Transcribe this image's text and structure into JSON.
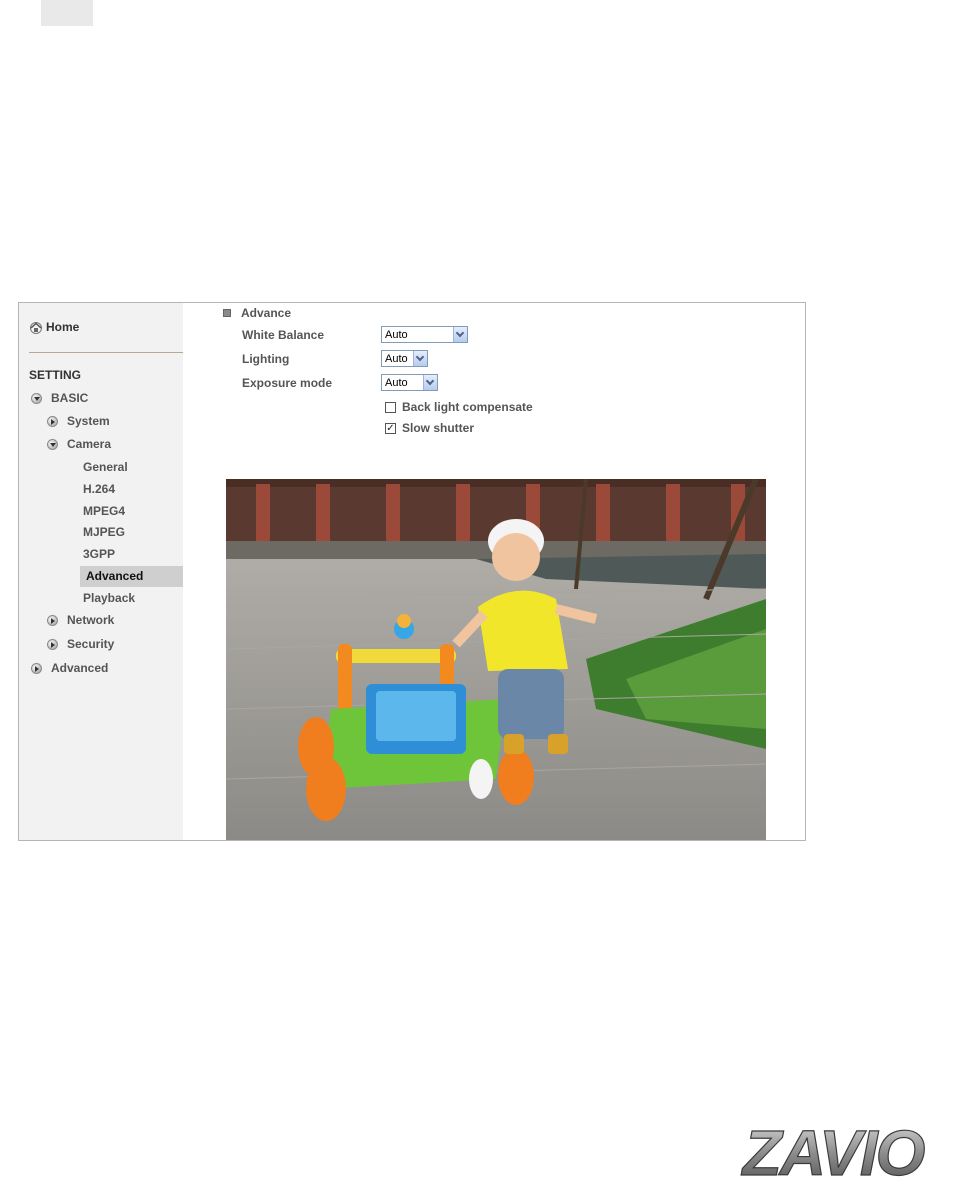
{
  "sidebar": {
    "home_label": "Home",
    "section_title": "SETTING",
    "basic_label": "BASIC",
    "system_label": "System",
    "camera_label": "Camera",
    "camera_sub": [
      "General",
      "H.264",
      "MPEG4",
      "MJPEG",
      "3GPP",
      "Advanced",
      "Playback"
    ],
    "network_label": "Network",
    "security_label": "Security",
    "advanced_label": "Advanced",
    "selected_item": "Advanced"
  },
  "content": {
    "section_title": "Advance",
    "white_balance_label": "White Balance",
    "white_balance_value": "Auto",
    "lighting_label": "Lighting",
    "lighting_value": "Auto",
    "exposure_label": "Exposure mode",
    "exposure_value": "Auto",
    "backlight_label": "Back light compensate",
    "backlight_checked": false,
    "slow_shutter_label": "Slow shutter",
    "slow_shutter_checked": true
  },
  "logo": {
    "text": "ZAVIO"
  },
  "colors": {
    "sidebar_bg": "#f2f2f2",
    "selected_bg": "#cfcfcf",
    "select_border": "#7f9db9"
  }
}
